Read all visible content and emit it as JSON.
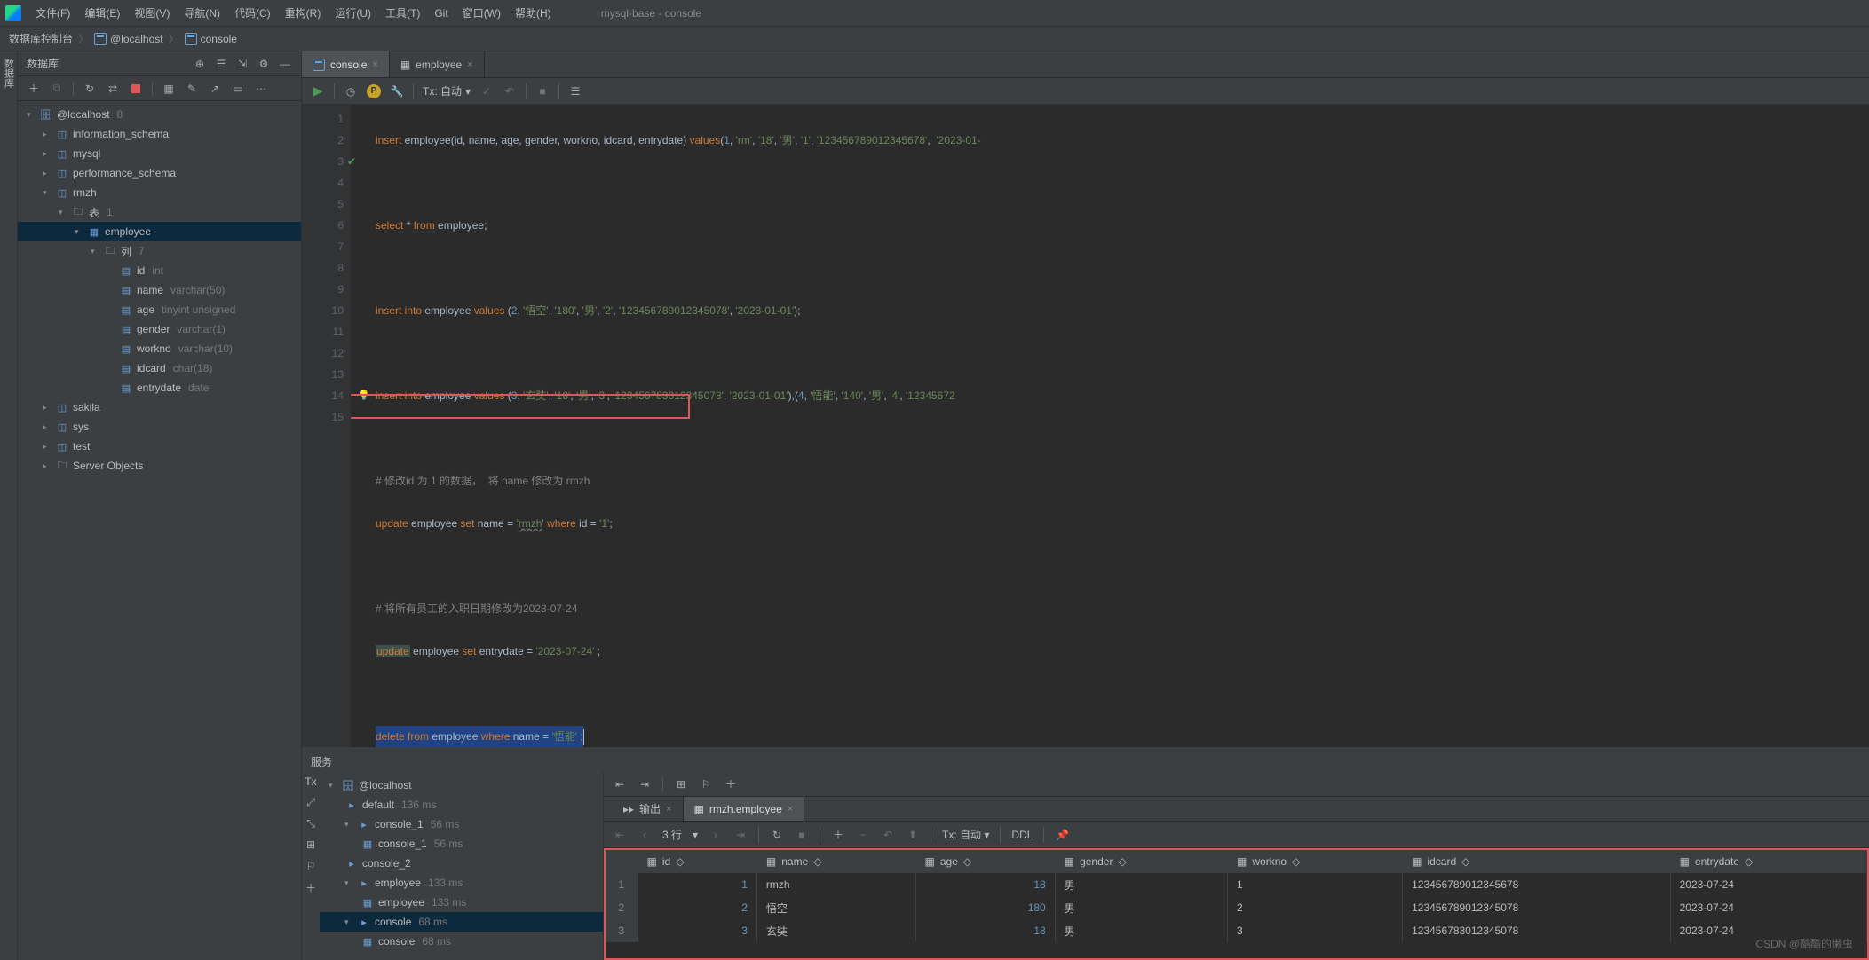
{
  "window_title": "mysql-base - console",
  "menu": [
    "文件(F)",
    "编辑(E)",
    "视图(V)",
    "导航(N)",
    "代码(C)",
    "重构(R)",
    "运行(U)",
    "工具(T)",
    "Git",
    "窗口(W)",
    "帮助(H)"
  ],
  "breadcrumbs": [
    "数据库控制台",
    "@localhost",
    "console"
  ],
  "sidebar": {
    "title": "数据库",
    "tree": {
      "host": "@localhost",
      "host_count": "8",
      "schemas": [
        "information_schema",
        "mysql",
        "performance_schema"
      ],
      "rmzh": {
        "name": "rmzh",
        "tables_label": "表",
        "tables_count": "1",
        "table": "employee",
        "cols_label": "列",
        "col_count": "7",
        "columns": [
          [
            "id",
            "int"
          ],
          [
            "name",
            "varchar(50)"
          ],
          [
            "age",
            "tinyint unsigned"
          ],
          [
            "gender",
            "varchar(1)"
          ],
          [
            "workno",
            "varchar(10)"
          ],
          [
            "idcard",
            "char(18)"
          ],
          [
            "entrydate",
            "date"
          ]
        ]
      },
      "after": [
        "sakila",
        "sys",
        "test",
        "Server Objects"
      ]
    }
  },
  "tabs": [
    {
      "label": "console",
      "active": true
    },
    {
      "label": "employee",
      "active": false
    }
  ],
  "runbar": {
    "tx_label": "Tx: 自动"
  },
  "code": {
    "line1_a": "insert",
    "line1_b": " employee(id, name, age, gender, workno, idcard, entrydate) ",
    "line1_c": "values",
    "line1_d": "(",
    "line1_n1": "1",
    "line1_e": ", ",
    "line1_s1": "'rm'",
    "line1_f": ", ",
    "line1_s2": "'18'",
    "line1_g": ", ",
    "line1_s3": "'男'",
    "line1_h": ", ",
    "line1_s4": "'1'",
    "line1_i": ", ",
    "line1_s5": "'123456789012345678'",
    "line1_j": ",  ",
    "line1_s6": "'2023-01-",
    "line3": "select * from employee;",
    "line5": "insert into employee values (2, '悟空', '180', '男', '2', '123456789012345078', '2023-01-01');",
    "line7": "insert into employee values (3, '玄奘', '18', '男', '3', '123456783012345078', '2023-01-01'),(4, '悟能', '140', '男', '4', '12345672",
    "line9": "# 修改id 为 1 的数据，  将 name 修改为 rmzh",
    "line10": "update employee set name = 'rmzh' where id = '1';",
    "line12": "# 将所有员工的入职日期修改为2023-07-24",
    "line13": "update employee set entrydate = '2023-07-24' ;",
    "line15": "delete from employee where name = '悟能' ;"
  },
  "services": {
    "title": "服务",
    "tree": {
      "host": "@localhost",
      "default": "default",
      "default_ms": "136 ms",
      "console_1": "console_1",
      "c1_ms": "56 ms",
      "console_1b": "console_1",
      "c1b_ms": "56 ms",
      "console_2": "console_2",
      "employee": "employee",
      "emp_ms": "133 ms",
      "employee_b": "employee",
      "empb_ms": "133 ms",
      "console": "console",
      "con_ms": "68 ms",
      "console_b": "console",
      "conb_ms": "68 ms"
    },
    "svc_tabs": [
      {
        "label": "输出",
        "icon": "output"
      },
      {
        "label": "rmzh.employee",
        "icon": "table",
        "active": true
      }
    ],
    "toolbar": {
      "rows": "3 行",
      "tx": "Tx: 自动",
      "ddl": "DDL"
    },
    "columns": [
      "id",
      "name",
      "age",
      "gender",
      "workno",
      "idcard",
      "entrydate"
    ],
    "rows": [
      {
        "n": "1",
        "id": "1",
        "name": "rmzh",
        "age": "18",
        "gender": "男",
        "workno": "1",
        "idcard": "123456789012345678",
        "entrydate": "2023-07-24"
      },
      {
        "n": "2",
        "id": "2",
        "name": "悟空",
        "age": "180",
        "gender": "男",
        "workno": "2",
        "idcard": "123456789012345078",
        "entrydate": "2023-07-24"
      },
      {
        "n": "3",
        "id": "3",
        "name": "玄奘",
        "age": "18",
        "gender": "男",
        "workno": "3",
        "idcard": "123456783012345078",
        "entrydate": "2023-07-24"
      }
    ]
  },
  "watermark": "CSDN @酷酷的懒虫"
}
